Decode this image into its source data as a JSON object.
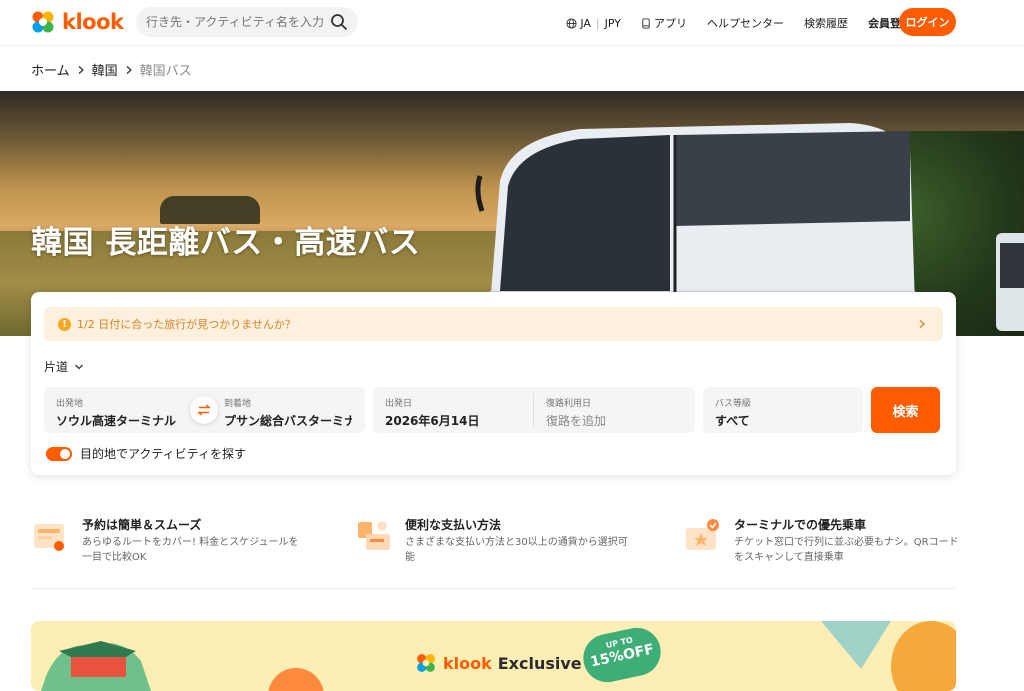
{
  "header": {
    "logo_text": "klook",
    "search_placeholder": "行き先・アクティビティ名を入力",
    "nav": {
      "language": "JA",
      "currency": "JPY",
      "app": "アプリ",
      "help": "ヘルプセンター",
      "history": "検索履歴",
      "signup": "会員登録（無料）"
    },
    "login": "ログイン"
  },
  "breadcrumb": {
    "home": "ホーム",
    "country": "韓国",
    "current": "韓国バス"
  },
  "hero": {
    "title": "韓国 長距離バス・高速バス"
  },
  "booking": {
    "notice": "1/2 日付に合った旅行が見つかりませんか？",
    "trip_type": "片道",
    "origin": {
      "label": "出発地",
      "value": "ソウル高速ターミナル"
    },
    "destination": {
      "label": "到着地",
      "value": "プサン総合バスターミナル"
    },
    "depart": {
      "label": "出発日",
      "value": "2026年6月14日"
    },
    "return": {
      "label": "復路利用日",
      "value": "復路を追加"
    },
    "bus_class": {
      "label": "バス等級",
      "value": "すべて"
    },
    "search_button": "検索",
    "activities_toggle": "目的地でアクティビティを探す"
  },
  "features": [
    {
      "title": "予約は簡単＆スムーズ",
      "desc": "あらゆるルートをカバー! 料金とスケジュールを一目で比較OK"
    },
    {
      "title": "便利な支払い方法",
      "desc": "さまざまな支払い方法と30以上の通貨から選択可能"
    },
    {
      "title": "ターミナルでの優先乗車",
      "desc": "チケット窓口で行列に並ぶ必要もナシ。QRコードをスキャンして直接乗車"
    }
  ],
  "banner": {
    "brand": "klook",
    "exclusive": "Exclusive",
    "promo_up": "UP TO",
    "promo_off": "15%OFF"
  },
  "colors": {
    "accent": "#ff5b00",
    "notice_bg": "#fdf1dd",
    "banner_bg": "#fdeeb5"
  }
}
